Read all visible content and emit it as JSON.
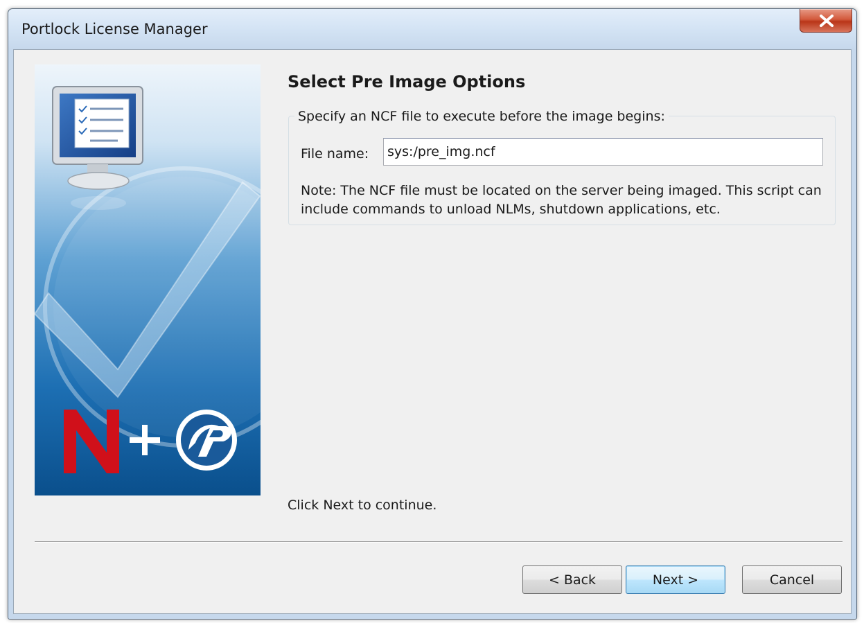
{
  "window": {
    "title": "Portlock License Manager"
  },
  "wizard": {
    "heading": "Select Pre Image Options",
    "group_label": "Specify an NCF file to execute before the image begins:",
    "file_name_label": "File name:",
    "file_name_value": "sys:/pre_img.ncf",
    "note": "Note: The NCF file must be located on the server being imaged. This script can include commands to unload NLMs, shutdown applications, etc.",
    "footer": "Click Next to continue."
  },
  "buttons": {
    "back": "< Back",
    "next": "Next >",
    "cancel": "Cancel"
  },
  "colors": {
    "banner_dark": "#0a4f8c",
    "banner_light": "#cde3f3",
    "novell_red": "#d0101a",
    "close_red": "#c8452a"
  },
  "icons": [
    "close-icon",
    "monitor-checklist-icon",
    "checkmark-graphic",
    "novell-logo-icon",
    "plus-icon",
    "portlock-logo-icon"
  ]
}
